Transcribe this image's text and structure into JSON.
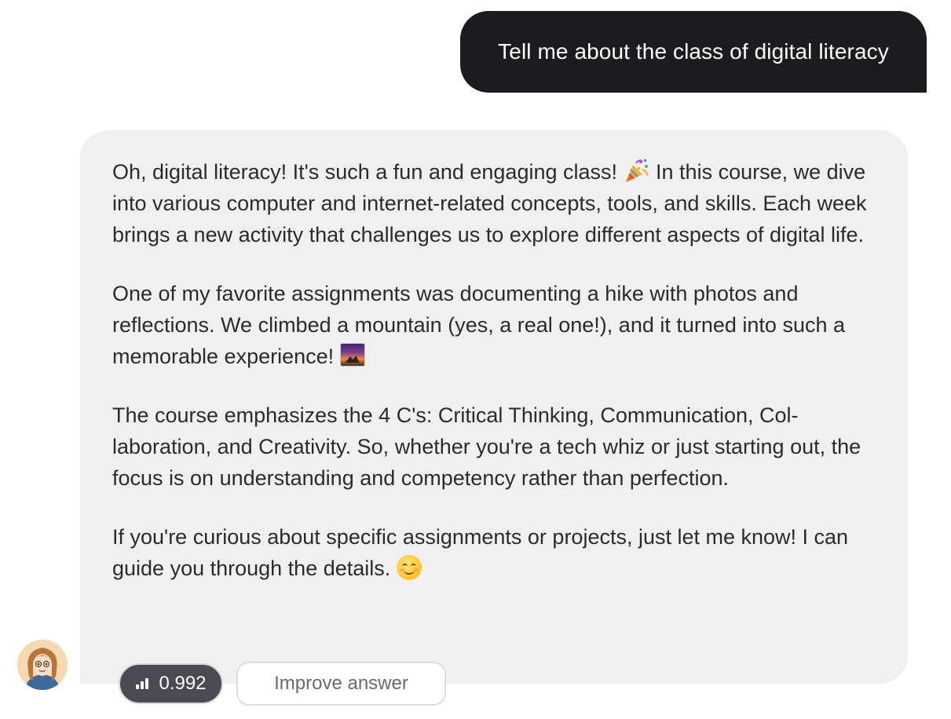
{
  "user_message": {
    "text": "Tell me about the class of digital literacy"
  },
  "assistant_message": {
    "p1_a": "Oh, digital literacy! It's such a fun and engaging class! ",
    "p1_emoji": "party-popper-emoji",
    "p1_b": " In this course, we dive into various computer and internet-related concepts, tools, and skills. Each week brings a new activity that challenges us to explore dif­ferent aspects of digital life.",
    "p2": "One of my favorite assignments was documenting a hike with photos and reflections. We climbed a mountain (yes, a real one!), and it turned into such a memorable experience! ",
    "p2_emoji": "sunrise-over-mountains-emoji",
    "p3": "The course emphasizes the 4 C's: Critical Thinking, Communication, Col­laboration, and Creativity. So, whether you're a tech whiz or just starting out, the focus is on understanding and competency rather than perfec­tion.",
    "p4": "If you're curious about specific assignments or projects, just let me know! I can guide you through the details. ",
    "p4_emoji": "smiling-face-emoji"
  },
  "footer": {
    "avatar_icon": "assistant-avatar-icon",
    "score_icon": "signal-bars-icon",
    "score_value": "0.992",
    "improve_label": "Improve answer"
  },
  "colors": {
    "user_bubble": "#1c1c1e",
    "assistant_bubble": "#f0f0f0",
    "score_pill": "#4a4a52"
  }
}
